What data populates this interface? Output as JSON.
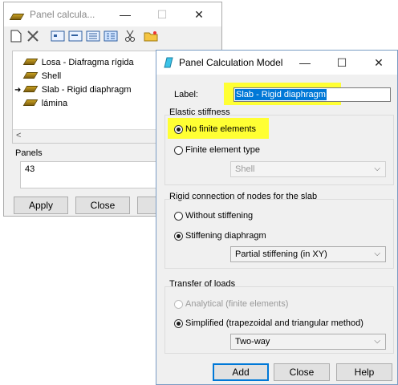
{
  "back_window": {
    "title": "Panel calcula...",
    "title_buttons": [
      "—",
      "☐",
      "✕"
    ],
    "toolbar": [
      "new-file-icon",
      "delete-icon",
      "view-1-icon",
      "view-2-icon",
      "view-3-icon",
      "view-4-icon",
      "scissors-icon",
      "folder-icon"
    ],
    "list_items": [
      {
        "label": "Losa - Diafragma rígida",
        "current": false
      },
      {
        "label": "Shell",
        "current": false
      },
      {
        "label": "Slab - Rigid diaphragm",
        "current": true
      },
      {
        "label": "lámina",
        "current": false
      }
    ],
    "scroll_left": "<",
    "panels_label": "Panels",
    "panels_value": "43",
    "apply_label": "Apply",
    "close_label": "Close"
  },
  "front_window": {
    "title": "Panel Calculation Model",
    "title_buttons": [
      "—",
      "☐",
      "✕"
    ],
    "label_caption": "Label:",
    "label_value": "Slab - Rigid diaphragm",
    "elastic": {
      "title": "Elastic stiffness",
      "opt1": "No finite elements",
      "opt2": "Finite element type",
      "select_value": "Shell"
    },
    "rigid": {
      "title": "Rigid connection of nodes for the slab",
      "opt1": "Without stiffening",
      "opt2": "Stiffening diaphragm",
      "select_value": "Partial stiffening (in XY)"
    },
    "transfer": {
      "title": "Transfer of loads",
      "opt1": "Analytical (finite elements)",
      "opt2": "Simplified (trapezoidal and triangular method)",
      "select_value": "Two-way"
    },
    "add_label": "Add",
    "close_label": "Close",
    "help_label": "Help"
  },
  "colors": {
    "highlight": "#ffff33",
    "selection": "#0078d7",
    "accent": "#0078d7"
  }
}
